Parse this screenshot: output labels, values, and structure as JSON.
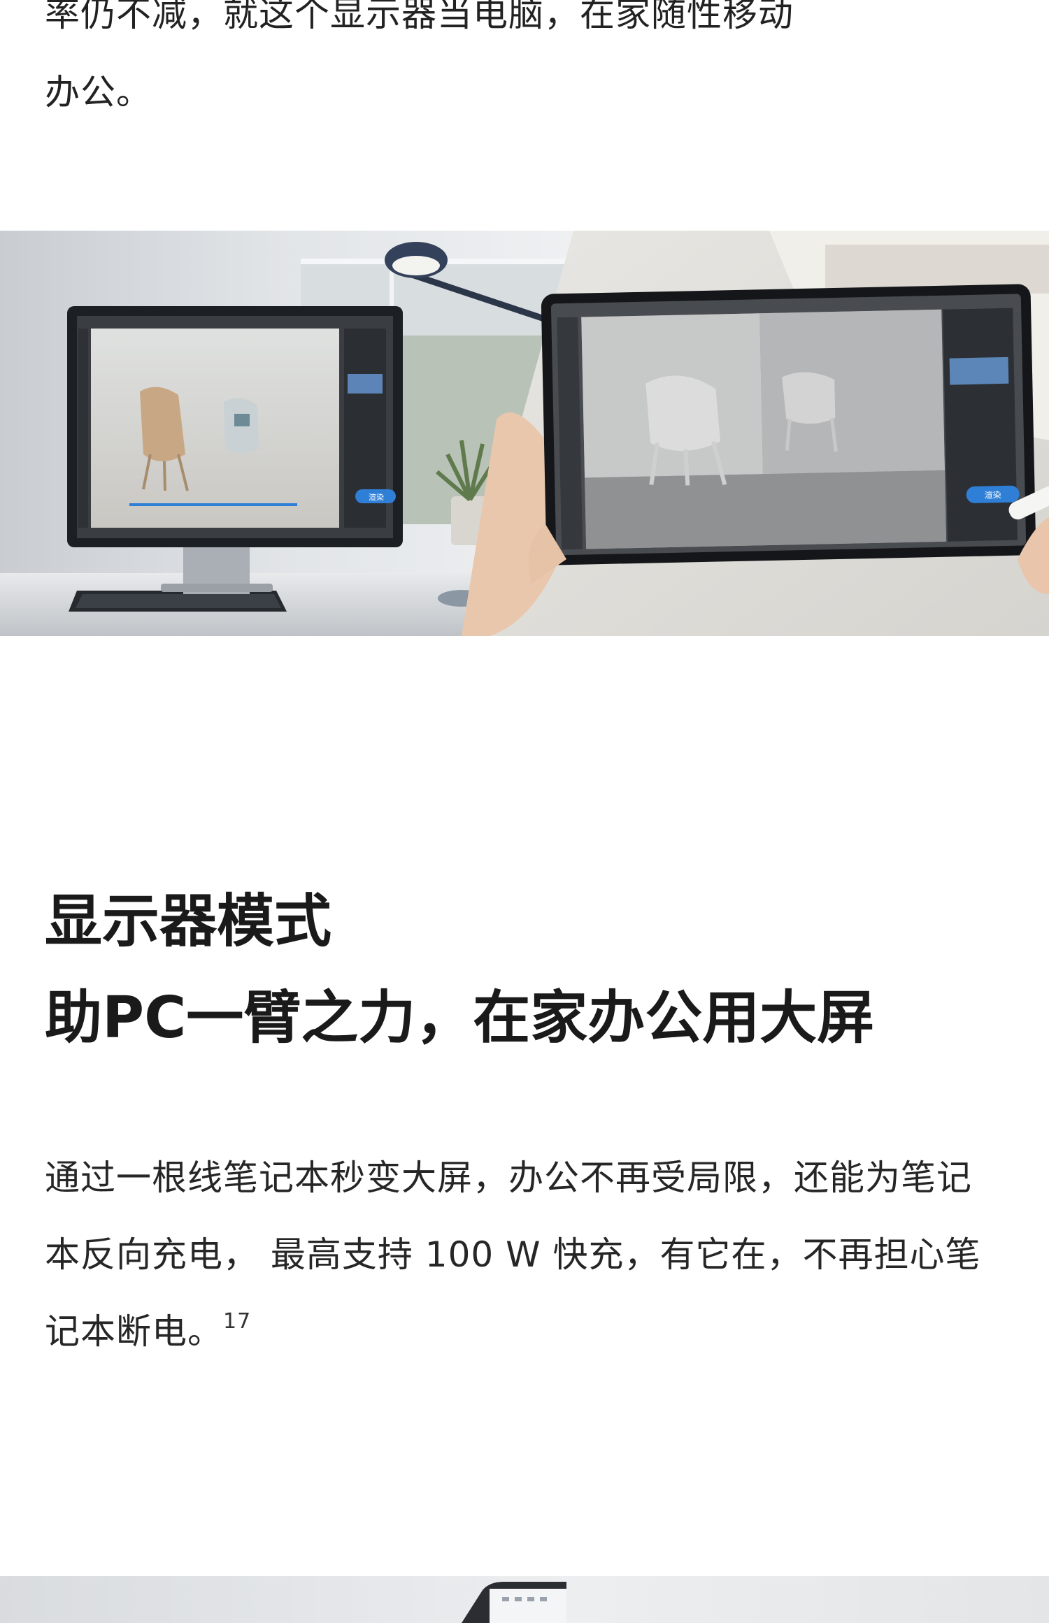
{
  "intro": {
    "partial_line": "率仍不减，就这个显示器当电脑，在家随性移动",
    "tail": "办公。"
  },
  "hero_image": {
    "monitor_button": "渲染",
    "tablet_button": "渲染"
  },
  "section": {
    "title_line1": "显示器模式",
    "title_line2": "助PC一臂之力，在家办公用大屏",
    "body": "通过一根线笔记本秒变大屏，办公不再受局限，还能为笔记本反向充电， 最高支持 100 W 快充，有它在，不再担心笔记本断电。",
    "footnote": "17"
  },
  "colors": {
    "text": "#1f1f1f",
    "accent_blue": "#2f7fd6",
    "background": "#ffffff"
  }
}
